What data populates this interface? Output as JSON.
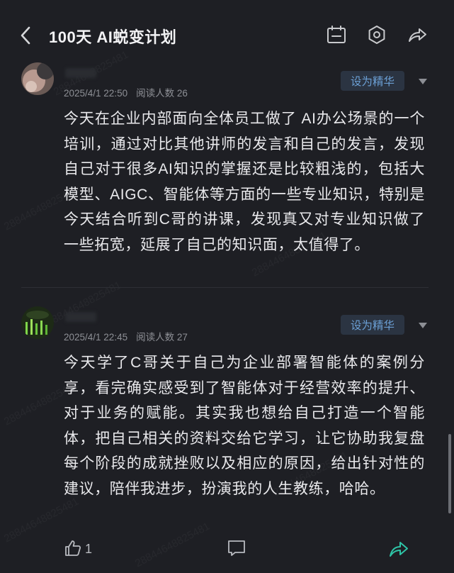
{
  "header": {
    "title": "100天 AI蜕变计划"
  },
  "posts": [
    {
      "date": "2025/4/1 22:50",
      "read_label": "阅读人数",
      "read_count": "26",
      "featured_label": "设为精华",
      "content": "今天在企业内部面向全体员工做了 AI办公场景的一个培训，通过对比其他讲师的发言和自己的发言，发现自己对于很多AI知识的掌握还是比较粗浅的，包括大模型、AIGC、智能体等方面的一些专业知识，特别是今天结合听到C哥的讲课，发现真又对专业知识做了一些拓宽，延展了自己的知识面，太值得了。"
    },
    {
      "date": "2025/4/1 22:45",
      "read_label": "阅读人数",
      "read_count": "27",
      "featured_label": "设为精华",
      "content": "今天学了C哥关于自己为企业部署智能体的案例分享，看完确实感受到了智能体对于经营效率的提升、对于业务的赋能。其实我也想给自己打造一个智能体，把自己相关的资料交给它学习，让它协助我复盘每个阶段的成就挫败以及相应的原因，给出针对性的建议，陪伴我进步，扮演我的人生教练，哈哈。"
    }
  ],
  "footer": {
    "like_count": "1"
  },
  "watermark": "28844648825481",
  "colors": {
    "background": "#1e1f24",
    "featured_bg": "#2b3442",
    "featured_text": "#6b9fd4",
    "share_accent": "#2ec4a6"
  }
}
